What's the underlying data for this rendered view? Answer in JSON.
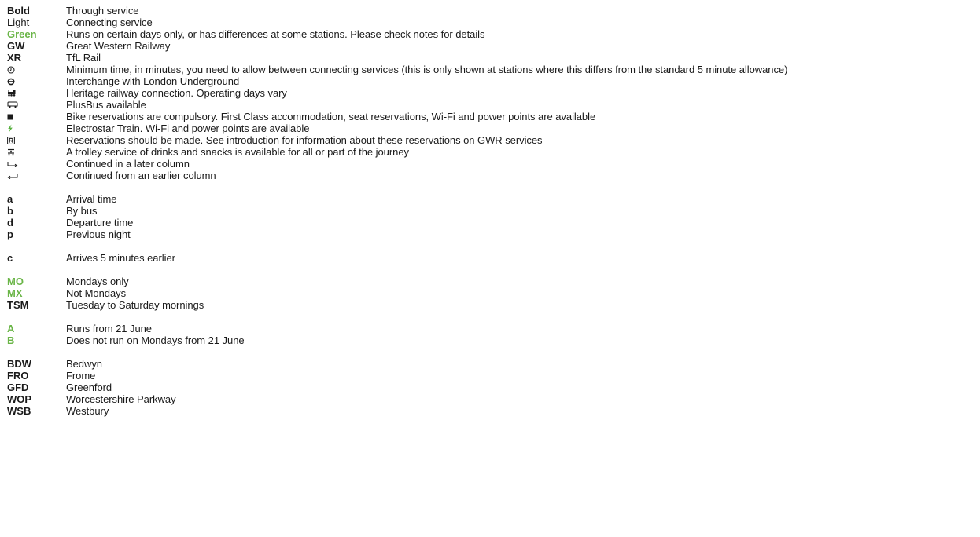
{
  "colors": {
    "text": "#1a1a1a",
    "green": "#6ab547",
    "electrostar": "#55b03c"
  },
  "legend": {
    "styles": [
      {
        "key": "Bold",
        "desc": "Through service"
      },
      {
        "key": "Light",
        "desc": "Connecting service"
      },
      {
        "key": "Green",
        "desc": "Runs on certain days only, or has differences at some stations. Please check notes for details"
      },
      {
        "key": "GW",
        "desc": "Great Western Railway"
      },
      {
        "key": "XR",
        "desc": "TfL Rail"
      }
    ],
    "symbols": [
      {
        "icon": "clock-icon",
        "desc": "Minimum time, in minutes, you need to allow between connecting services (this is only shown at stations where this differs from the standard 5 minute allowance)"
      },
      {
        "icon": "underground-icon",
        "desc": "Interchange with London Underground"
      },
      {
        "icon": "heritage-railway-icon",
        "desc": "Heritage railway connection. Operating days vary"
      },
      {
        "icon": "plusbus-icon",
        "desc": "PlusBus available"
      },
      {
        "icon": "black-square-icon",
        "desc": "Bike reservations are compulsory. First Class accommodation, seat reservations, Wi-Fi and power points are available"
      },
      {
        "icon": "lightning-icon",
        "desc": "Electrostar Train. Wi-Fi and power points are available"
      },
      {
        "icon": "reservation-r-icon",
        "desc": "Reservations should be made. See introduction for information about these reservations on GWR services"
      },
      {
        "icon": "trolley-icon",
        "desc": "A trolley service of drinks and snacks is available for all or part of the journey"
      },
      {
        "icon": "continued-later-arrow-icon",
        "desc": "Continued in a later column"
      },
      {
        "icon": "continued-earlier-arrow-icon",
        "desc": "Continued from an earlier column"
      }
    ],
    "letters": [
      {
        "key": "a",
        "desc": "Arrival time"
      },
      {
        "key": "b",
        "desc": "By bus"
      },
      {
        "key": "d",
        "desc": "Departure time"
      },
      {
        "key": "p",
        "desc": "Previous night"
      }
    ],
    "notes": [
      {
        "key": "c",
        "desc": "Arrives 5 minutes earlier"
      }
    ],
    "days": [
      {
        "key": "MO",
        "desc": "Mondays only"
      },
      {
        "key": "MX",
        "desc": "Not Mondays"
      },
      {
        "key": "TSM",
        "desc": "Tuesday to Saturday mornings"
      }
    ],
    "dates": [
      {
        "key": "A",
        "desc": "Runs from 21 June"
      },
      {
        "key": "B",
        "desc": "Does not run on Mondays from 21 June"
      }
    ],
    "stations": [
      {
        "key": "BDW",
        "desc": "Bedwyn"
      },
      {
        "key": "FRO",
        "desc": "Frome"
      },
      {
        "key": "GFD",
        "desc": "Greenford"
      },
      {
        "key": "WOP",
        "desc": "Worcestershire Parkway"
      },
      {
        "key": "WSB",
        "desc": "Westbury"
      }
    ]
  }
}
